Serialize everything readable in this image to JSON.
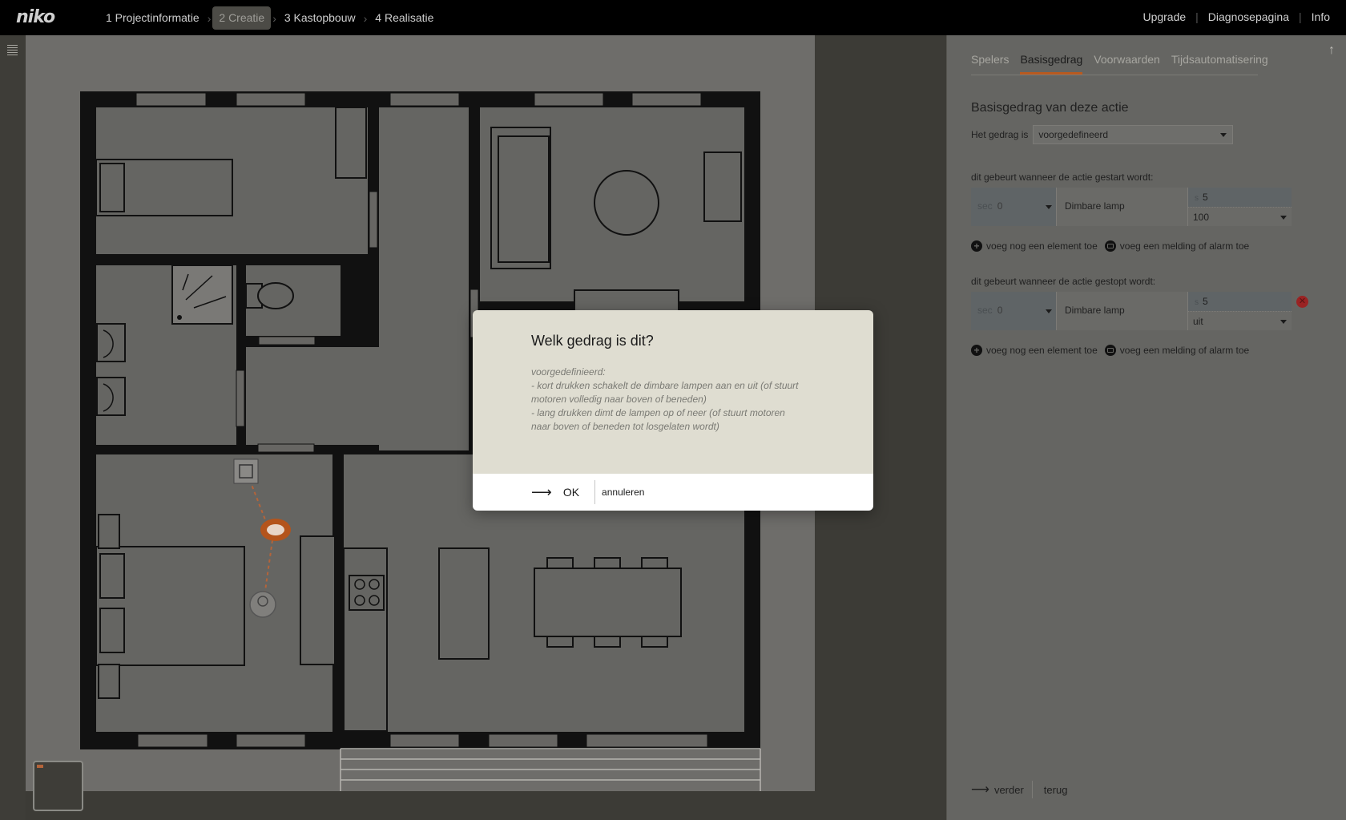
{
  "topbar": {
    "logo": "niko",
    "steps": [
      "1 Projectinformatie",
      "2 Creatie",
      "3 Kastopbouw",
      "4 Realisatie"
    ],
    "active_step": 1,
    "links": [
      "Upgrade",
      "Diagnosepagina",
      "Info"
    ]
  },
  "panel": {
    "tabs": [
      "Spelers",
      "Basisgedrag",
      "Voorwaarden",
      "Tijdsautomatisering"
    ],
    "active_tab": "Basisgedrag",
    "section_title": "Basisgedrag van deze actie",
    "gedrag_label": "Het gedrag is",
    "gedrag_value": "voorgedefineerd",
    "start": {
      "label": "dit gebeurt wanneer de actie gestart wordt:",
      "sec_unit": "sec",
      "sec_value": "0",
      "device": "Dimbare lamp",
      "s_unit": "s",
      "s_value": "5",
      "level": "100"
    },
    "stop": {
      "label": "dit gebeurt wanneer de actie gestopt wordt:",
      "sec_unit": "sec",
      "sec_value": "0",
      "device": "Dimbare lamp",
      "s_unit": "s",
      "s_value": "5",
      "level": "uit"
    },
    "add_element": "voeg nog een element toe",
    "add_alarm": "voeg een melding of alarm toe",
    "next": "verder",
    "back": "terug"
  },
  "modal": {
    "title": "Welk gedrag is dit?",
    "lines": [
      "voorgedefinieerd:",
      "- kort drukken schakelt de dimbare lampen aan en uit (of stuurt motoren volledig naar boven of beneden)",
      "- lang drukken dimt de lampen op of neer (of stuurt motoren naar boven of beneden tot losgelaten wordt)"
    ],
    "ok": "OK",
    "cancel": "annuleren"
  },
  "colors": {
    "accent": "#b85a1f",
    "overlay_bg": "#3c3b36",
    "modal_bg": "#dfddd1"
  }
}
